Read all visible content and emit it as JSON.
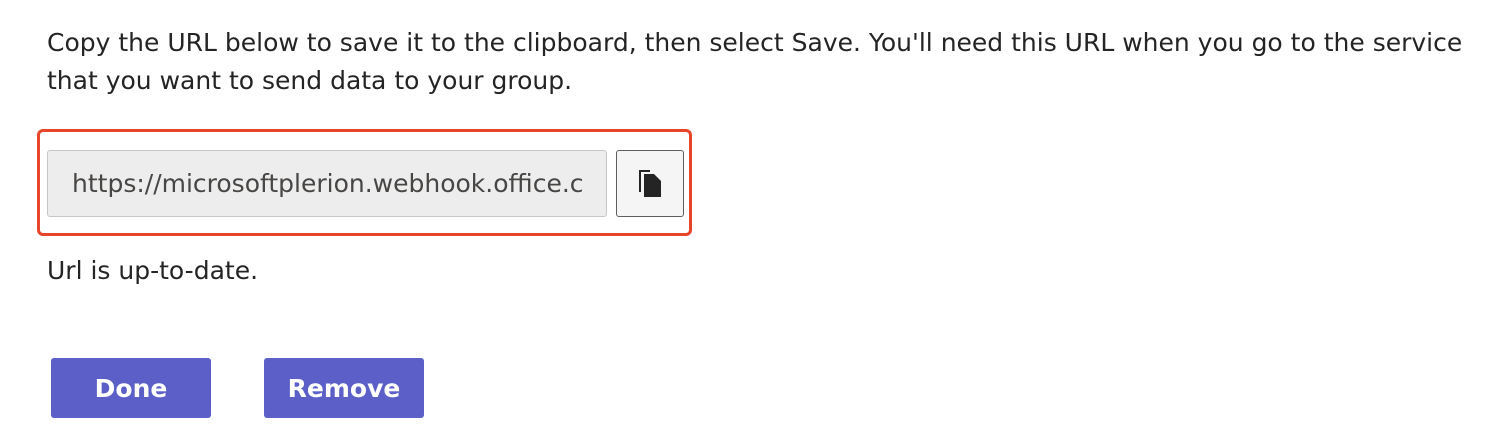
{
  "instructions": "Copy the URL below to save it to the clipboard, then select Save. You'll need this URL when you go to the service that you want to send data to your group.",
  "url_field": {
    "value": "https://microsoftplerion.webhook.office.c"
  },
  "copy_button": {
    "icon": "copy-icon"
  },
  "status": "Url is up-to-date.",
  "buttons": {
    "done_label": "Done",
    "remove_label": "Remove"
  },
  "colors": {
    "accent": "#5b5fc7",
    "highlight": "#e8462a"
  }
}
